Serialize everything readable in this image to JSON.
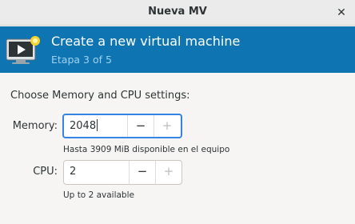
{
  "window": {
    "title": "Nueva MV",
    "close_glyph": "✕"
  },
  "banner": {
    "icon": "vm-monitor-new-icon",
    "headline": "Create a new virtual machine",
    "step": "Etapa 3 of 5",
    "accent": "#0f75b2"
  },
  "main": {
    "section_title": "Choose Memory and CPU settings:",
    "memory": {
      "label": "Memory:",
      "value": "2048",
      "decrement": "−",
      "increment": "+",
      "hint": "Hasta 3909 MiB disponible en el equipo"
    },
    "cpu": {
      "label": "CPU:",
      "value": "2",
      "decrement": "−",
      "increment": "+",
      "hint": "Up to 2 available"
    }
  }
}
